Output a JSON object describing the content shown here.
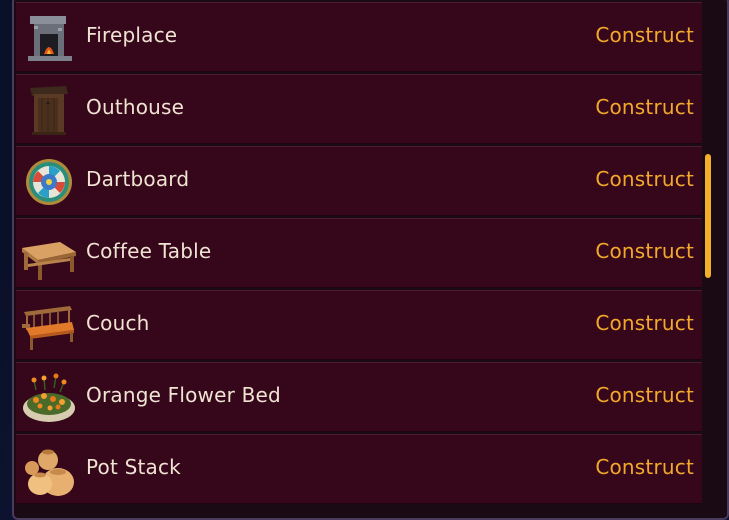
{
  "rows": [
    {
      "name": "Fireplace",
      "action": "Construct",
      "icon": "fireplace-icon"
    },
    {
      "name": "Outhouse",
      "action": "Construct",
      "icon": "outhouse-icon"
    },
    {
      "name": "Dartboard",
      "action": "Construct",
      "icon": "dartboard-icon"
    },
    {
      "name": "Coffee Table",
      "action": "Construct",
      "icon": "coffee-table-icon"
    },
    {
      "name": "Couch",
      "action": "Construct",
      "icon": "couch-icon"
    },
    {
      "name": "Orange Flower Bed",
      "action": "Construct",
      "icon": "orange-flower-bed-icon"
    },
    {
      "name": "Pot Stack",
      "action": "Construct",
      "icon": "pot-stack-icon"
    }
  ],
  "colors": {
    "row_background": "#36071a",
    "action_text": "#f2a92b",
    "name_text": "#efe3d2",
    "scrollbar_thumb": "#f2b02a"
  }
}
